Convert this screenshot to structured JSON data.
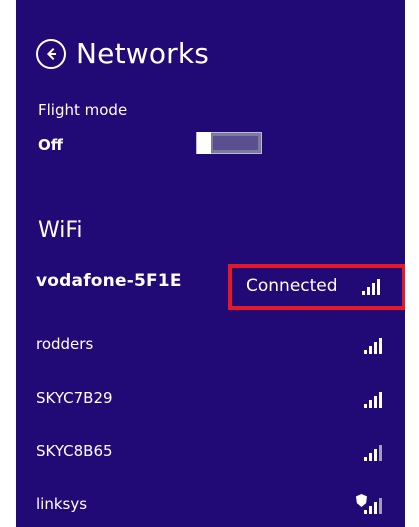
{
  "header": {
    "title": "Networks",
    "back_label": "Back"
  },
  "flight_mode": {
    "label": "Flight mode",
    "state": "Off"
  },
  "wifi": {
    "title": "WiFi",
    "networks": [
      {
        "name": "vodafone-5F1E",
        "status": "Connected",
        "signal_bars": 4,
        "icon": "wifi-signal-icon"
      },
      {
        "name": "rodders",
        "status": "",
        "signal_bars": 4,
        "icon": "wifi-signal-icon"
      },
      {
        "name": "SKYC7B29",
        "status": "",
        "signal_bars": 4,
        "icon": "wifi-signal-icon"
      },
      {
        "name": "SKYC8B65",
        "status": "",
        "signal_bars": 4,
        "icon": "wifi-signal-icon"
      },
      {
        "name": "linksys",
        "status": "",
        "signal_bars": 4,
        "icon": "secured-wifi-signal-icon"
      }
    ]
  },
  "colors": {
    "panel_bg": "#210a76",
    "text": "#ffffff",
    "highlight": "#e51827"
  },
  "icons": {
    "back": "back-arrow-icon",
    "toggle": "toggle-switch-icon",
    "signal": "wifi-signal-icon"
  }
}
